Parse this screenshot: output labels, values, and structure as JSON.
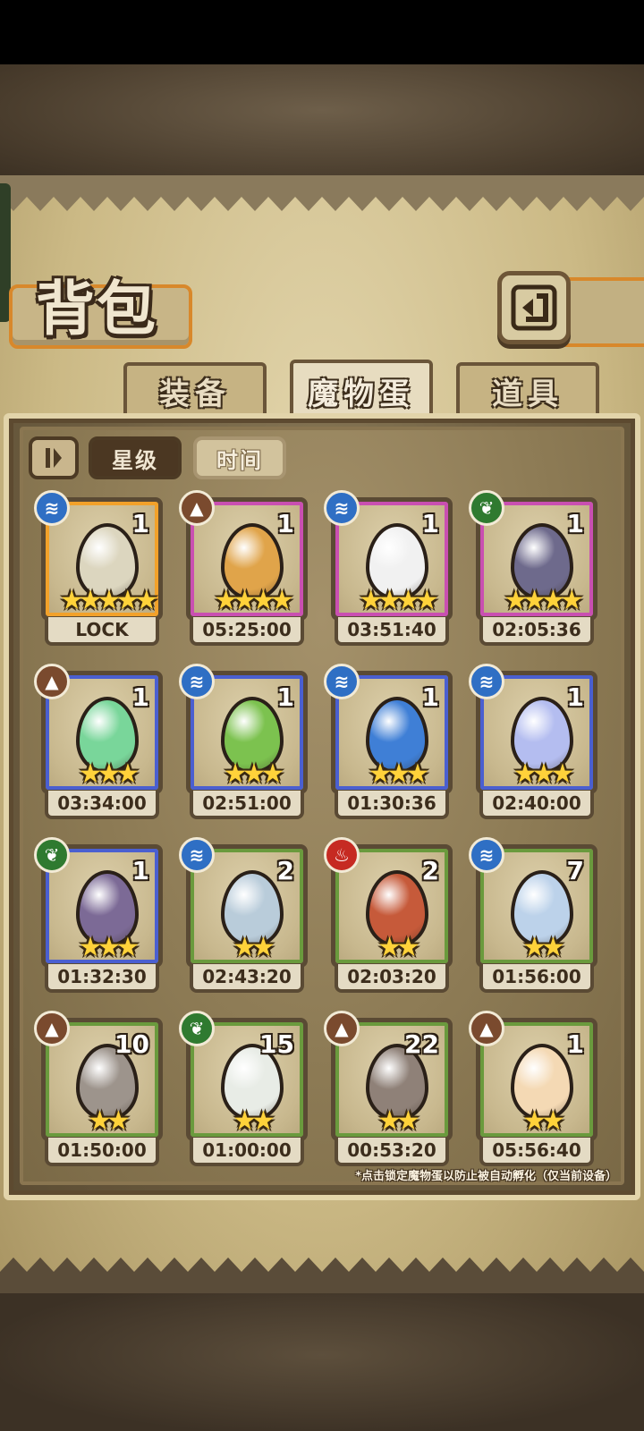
{
  "header": {
    "title": "背包"
  },
  "back_button": {
    "icon": "back-arrow-icon"
  },
  "tabs": [
    {
      "label": "装备",
      "active": false
    },
    {
      "label": "魔物蛋",
      "active": true
    },
    {
      "label": "道具",
      "active": false
    }
  ],
  "sort": {
    "star_label": "星级",
    "time_label": "时间",
    "active": "星级"
  },
  "element_colors": {
    "water": "#2f6fc4",
    "earth": "#7a4a2e",
    "nature": "#2f7a30",
    "fire": "#c62a22"
  },
  "rarity_colors": {
    "gold": "#f2a12a",
    "purple": "#c94fb1",
    "blue": "#4a5fd0",
    "green": "#6a9a3d"
  },
  "eggs": [
    {
      "element": "water",
      "rarity": "gold",
      "count": "1",
      "stars": "★★★★★",
      "timer": "LOCK",
      "color": "#dcd6bf"
    },
    {
      "element": "earth",
      "rarity": "purple",
      "count": "1",
      "stars": "★★★★",
      "timer": "05:25:00",
      "color": "#e0a44a"
    },
    {
      "element": "water",
      "rarity": "purple",
      "count": "1",
      "stars": "★★★★",
      "timer": "03:51:40",
      "color": "#f1f1f1"
    },
    {
      "element": "nature",
      "rarity": "purple",
      "count": "1",
      "stars": "★★★★",
      "timer": "02:05:36",
      "color": "#6e6a8c"
    },
    {
      "element": "earth",
      "rarity": "blue",
      "count": "1",
      "stars": "★★★",
      "timer": "03:34:00",
      "color": "#79d69a"
    },
    {
      "element": "water",
      "rarity": "blue",
      "count": "1",
      "stars": "★★★",
      "timer": "02:51:00",
      "color": "#7cc24f"
    },
    {
      "element": "water",
      "rarity": "blue",
      "count": "1",
      "stars": "★★★",
      "timer": "01:30:36",
      "color": "#3f7fd6"
    },
    {
      "element": "water",
      "rarity": "blue",
      "count": "1",
      "stars": "★★★",
      "timer": "02:40:00",
      "color": "#b4bdf0"
    },
    {
      "element": "nature",
      "rarity": "blue",
      "count": "1",
      "stars": "★★★",
      "timer": "01:32:30",
      "color": "#7c6a96"
    },
    {
      "element": "water",
      "rarity": "green",
      "count": "2",
      "stars": "★★",
      "timer": "02:43:20",
      "color": "#b9ccda"
    },
    {
      "element": "fire",
      "rarity": "green",
      "count": "2",
      "stars": "★★",
      "timer": "02:03:20",
      "color": "#c65a3a"
    },
    {
      "element": "water",
      "rarity": "green",
      "count": "7",
      "stars": "★★",
      "timer": "01:56:00",
      "color": "#bcd2ea"
    },
    {
      "element": "earth",
      "rarity": "green",
      "count": "10",
      "stars": "★★",
      "timer": "01:50:00",
      "color": "#9d948c"
    },
    {
      "element": "nature",
      "rarity": "green",
      "count": "15",
      "stars": "★★",
      "timer": "01:00:00",
      "color": "#e8ece6"
    },
    {
      "element": "earth",
      "rarity": "green",
      "count": "22",
      "stars": "★★",
      "timer": "00:53:20",
      "color": "#8f8178"
    },
    {
      "element": "earth",
      "rarity": "green",
      "count": "1",
      "stars": "★★",
      "timer": "05:56:40",
      "color": "#f4d9b4"
    }
  ],
  "footer_note": "*点击锁定魔物蛋以防止被自动孵化（仅当前设备）"
}
